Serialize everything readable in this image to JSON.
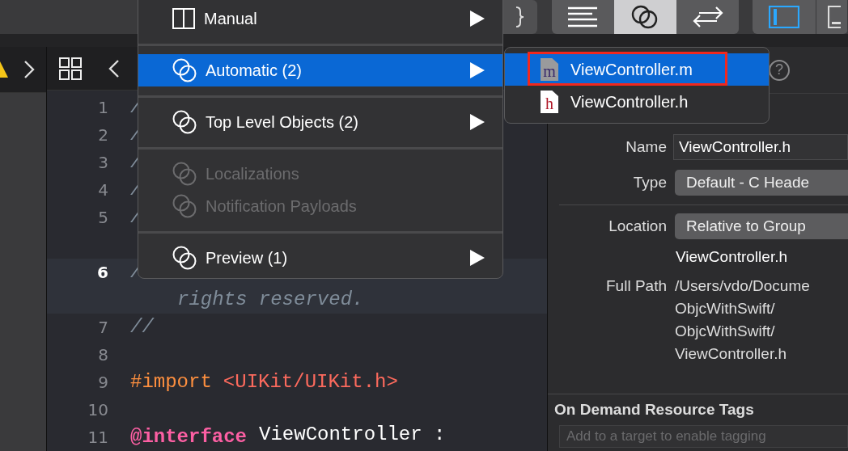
{
  "toolbar": {
    "editor_modes": [
      {
        "kind": "standard",
        "selected": false
      },
      {
        "kind": "assistant",
        "selected": true
      },
      {
        "kind": "version",
        "selected": false
      }
    ],
    "panels": [
      {
        "kind": "navigator",
        "on": true
      },
      {
        "kind": "debug",
        "on": false
      }
    ]
  },
  "editor": {
    "lines": [
      {
        "number": "1",
        "current": false,
        "tokens": [
          {
            "kind": "comment",
            "text": "/"
          }
        ]
      },
      {
        "number": "2",
        "current": false,
        "tokens": [
          {
            "kind": "comment",
            "text": "/"
          }
        ]
      },
      {
        "number": "3",
        "current": false,
        "tokens": [
          {
            "kind": "comment",
            "text": "/"
          }
        ]
      },
      {
        "number": "4",
        "current": false,
        "tokens": [
          {
            "kind": "comment",
            "text": "/"
          }
        ]
      },
      {
        "number": "5",
        "current": false,
        "tokens": [
          {
            "kind": "comment",
            "text": "/"
          }
        ]
      },
      {
        "number": "6",
        "current": true,
        "tokens": [
          {
            "kind": "comment",
            "text": "/"
          }
        ],
        "continuation": "rights reserved."
      },
      {
        "number": "7",
        "current": false,
        "tokens": [
          {
            "kind": "comment",
            "text": "//"
          }
        ]
      },
      {
        "number": "8",
        "current": false
      },
      {
        "number": "9",
        "current": false,
        "tokens": [
          {
            "kind": "directive",
            "text": "#import"
          },
          {
            "kind": "string",
            "text": "<UIKit/UIKit.h>"
          }
        ]
      },
      {
        "number": "10",
        "current": false
      },
      {
        "number": "11",
        "current": false,
        "tokens": [
          {
            "kind": "keyword",
            "text": "@interface"
          },
          {
            "kind": "plain",
            "text": "ViewController :"
          }
        ]
      }
    ]
  },
  "menu": {
    "items": [
      {
        "kind": "split_item",
        "label": "Manual",
        "selected": false,
        "disabled": false,
        "submenu": true
      },
      {
        "kind": "separator"
      },
      {
        "kind": "related_item",
        "label": "Automatic (2)",
        "selected": true,
        "disabled": false,
        "submenu": true
      },
      {
        "kind": "separator"
      },
      {
        "kind": "related_item",
        "label": "Top Level Objects (2)",
        "selected": false,
        "disabled": false,
        "submenu": true
      },
      {
        "kind": "separator"
      },
      {
        "kind": "related_item",
        "label": "Localizations",
        "selected": false,
        "disabled": true,
        "submenu": false
      },
      {
        "kind": "related_item",
        "label": "Notification Payloads",
        "selected": false,
        "disabled": true,
        "submenu": false
      },
      {
        "kind": "separator"
      },
      {
        "kind": "related_item",
        "label": "Preview (1)",
        "selected": false,
        "disabled": false,
        "submenu": true
      }
    ]
  },
  "submenu": {
    "items": [
      {
        "kind": "implementation",
        "badge": "m",
        "label": "ViewController.m",
        "selected": true,
        "outlined": true
      },
      {
        "kind": "header",
        "badge": "h",
        "label": "ViewController.h",
        "selected": false,
        "outlined": false
      }
    ]
  },
  "inspector": {
    "help": "?",
    "identity": [
      {
        "label": "Name",
        "kind": "text",
        "value": "ViewController.h"
      },
      {
        "label": "Type",
        "kind": "popup",
        "value": "Default - C Heade"
      }
    ],
    "location": {
      "label": "Location",
      "value": "Relative to Group",
      "file_name": "ViewController.h"
    },
    "full_path": {
      "label": "Full Path",
      "lines": [
        "/Users/vdo/Docume",
        "ObjcWithSwift/",
        "ObjcWithSwift/",
        "ViewController.h"
      ]
    },
    "tags": {
      "title": "On Demand Resource Tags",
      "placeholder": "Add to a target to enable tagging"
    }
  }
}
